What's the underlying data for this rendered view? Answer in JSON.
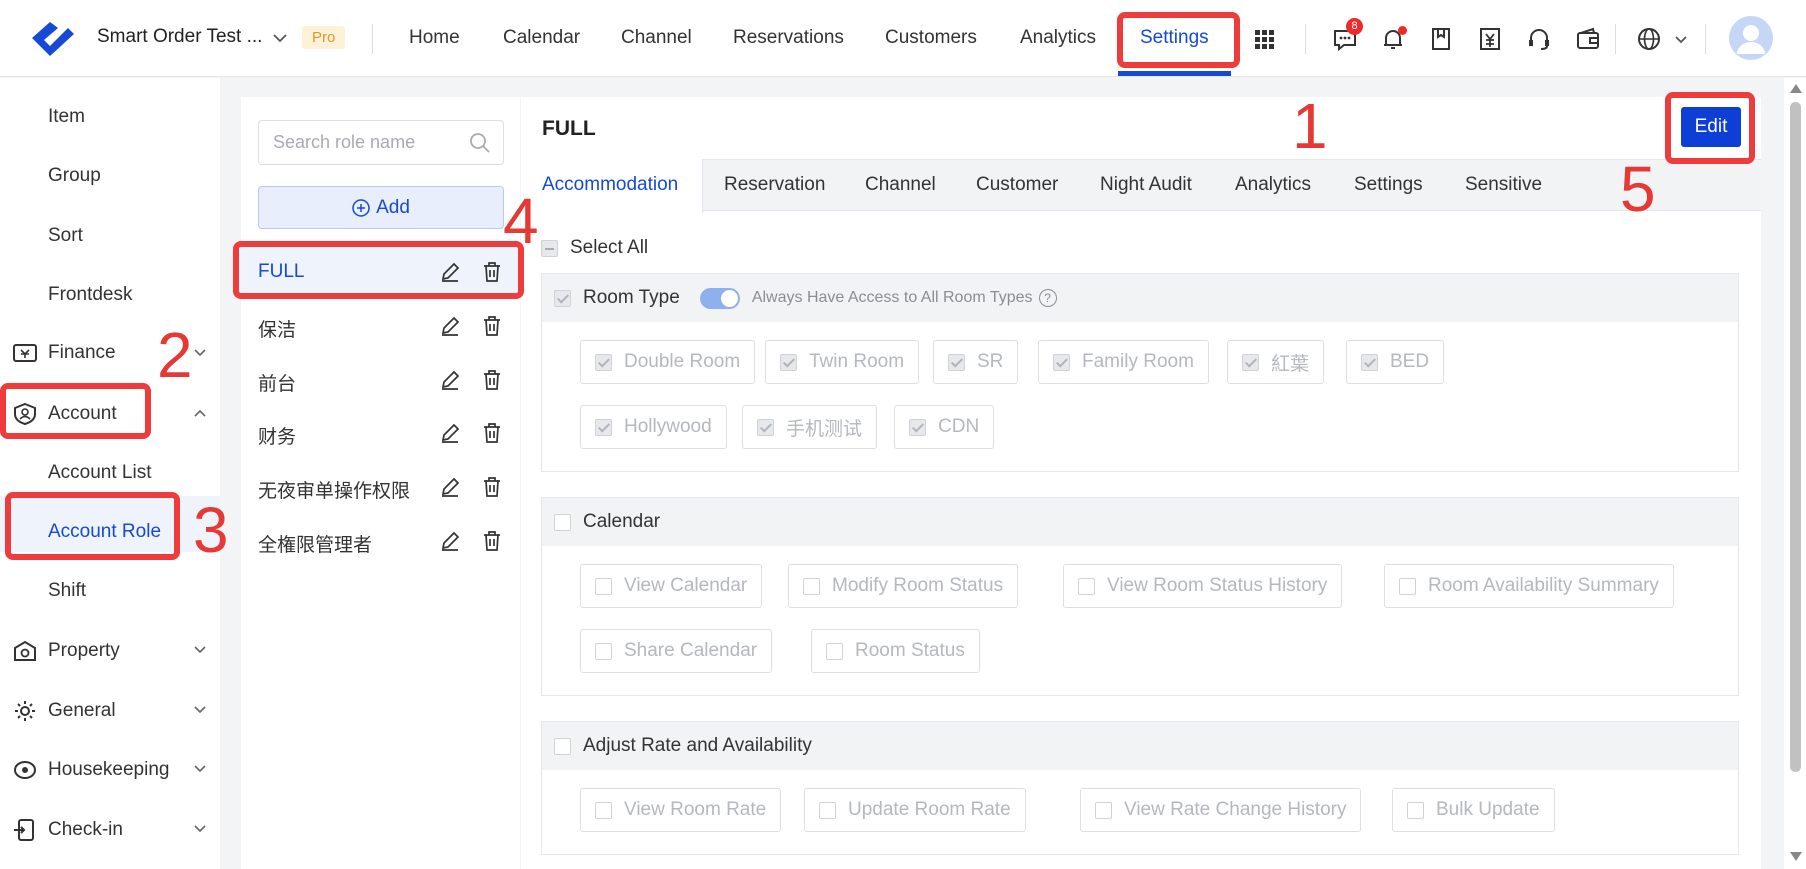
{
  "header": {
    "company": "Smart Order Test ...",
    "plan_badge": "Pro",
    "nav": [
      {
        "label": "Home"
      },
      {
        "label": "Calendar"
      },
      {
        "label": "Channel"
      },
      {
        "label": "Reservations"
      },
      {
        "label": "Customers"
      },
      {
        "label": "Analytics"
      },
      {
        "label": "Settings",
        "active": true
      }
    ],
    "message_badge": "8",
    "icons": [
      "apps-grid-icon",
      "message-icon",
      "bell-icon",
      "bookmark-icon",
      "invoice-icon",
      "headset-icon",
      "wallet-icon",
      "globe-icon",
      "avatar"
    ]
  },
  "sidebar": {
    "subitems_top": [
      "Item",
      "Group",
      "Sort",
      "Frontdesk"
    ],
    "finance": "Finance",
    "account": "Account",
    "account_items": [
      "Account List",
      "Account Role",
      "Shift"
    ],
    "active_item": "Account Role",
    "groups_bottom": [
      "Property",
      "General",
      "Housekeeping",
      "Check-in"
    ]
  },
  "roles": {
    "search_placeholder": "Search role name",
    "add_label": "Add",
    "items": [
      "FULL",
      "保洁",
      "前台",
      "财务",
      "无夜审单操作权限",
      "全権限管理者"
    ],
    "active": "FULL"
  },
  "main": {
    "title": "FULL",
    "edit_label": "Edit",
    "tabs": [
      "Accommodation",
      "Reservation",
      "Channel",
      "Customer",
      "Night Audit",
      "Analytics",
      "Settings",
      "Sensitive"
    ],
    "active_tab": "Accommodation",
    "select_all": "Select All",
    "room_type": {
      "label": "Room Type",
      "access_label": "Always Have Access to All Room Types",
      "options": [
        "Double Room",
        "Twin Room",
        "SR",
        "Family Room",
        "紅葉",
        "BED",
        "Hollywood",
        "手机测试",
        "CDN"
      ]
    },
    "calendar": {
      "label": "Calendar",
      "options": [
        "View Calendar",
        "Modify Room Status",
        "View Room Status History",
        "Room Availability Summary",
        "Share Calendar",
        "Room Status"
      ]
    },
    "adjust_rate": {
      "label": "Adjust Rate and Availability",
      "options": [
        "View Room Rate",
        "Update Room Rate",
        "View Rate Change History",
        "Bulk Update"
      ]
    }
  },
  "annotations": [
    "1",
    "2",
    "3",
    "4",
    "5"
  ],
  "colors": {
    "accent": "#1549d6",
    "annotation": "#ee3b3b",
    "edit_button": "#0d3fd6"
  }
}
